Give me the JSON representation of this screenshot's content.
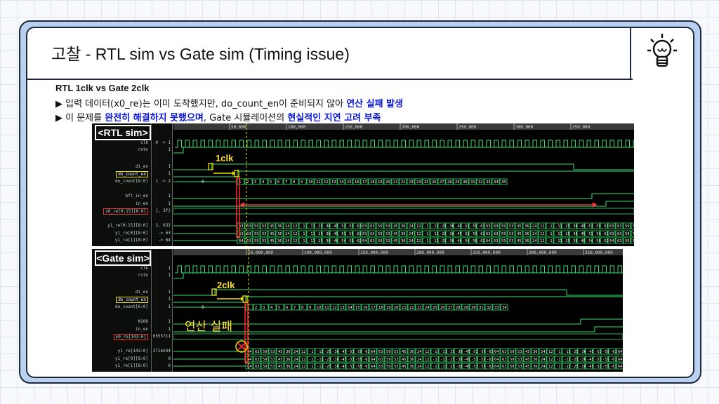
{
  "slide": {
    "title_kr": "고찰",
    "title_rest": " - RTL sim vs Gate sim (Timing issue)",
    "subtitle": "RTL 1clk vs Gate 2clk",
    "line1_a": "▶ 입력 데이터(x0_re)는 이미 도착했지만, do_count_en이 준비되지 않아 ",
    "line1_b": "연산 실패 발생",
    "line2_a": "▶ 이 문제를 ",
    "line2_b": "완전히 해결하지 못했으며",
    "line2_c": ", Gate 시뮬레이션의 ",
    "line2_d": "현실적인 지연 고려 부족",
    "icon": "lightbulb-icon"
  },
  "rtl": {
    "label": "<RTL sim>",
    "signals": [
      "clk",
      "rstn",
      "di_en",
      "do_count_en",
      "do_count[6:0]",
      "bfl_in_en",
      "in_en",
      "x0_re[0:15][8:0]",
      "y1_re[0:15][8:0]",
      "y1_re[0][8:0]",
      "y1_re[1][8:0]"
    ],
    "values": [
      "0 -> 1",
      "1",
      "1",
      "1",
      "1 -> 2",
      "1",
      "1",
      "{, 3f}",
      "3, 63}",
      "-> 63",
      "-> 64"
    ],
    "annotation": "1clk",
    "time_ticks": [
      "50,000",
      "100,000",
      "150,000",
      "200,000",
      "250,000",
      "300,000",
      "350,000"
    ],
    "counts": [
      "0",
      "1",
      "2",
      "3",
      "4",
      "5",
      "6",
      "7",
      "8",
      "9",
      "10",
      "11",
      "12",
      "13",
      "14",
      "15",
      "16",
      "17",
      "18",
      "19",
      "20",
      "21",
      "22",
      "23",
      "24",
      "25",
      "26",
      "27",
      "28",
      "29",
      "30",
      "31",
      "32",
      "33",
      "34",
      "35"
    ],
    "y0": [
      "63",
      "63",
      "59",
      "53",
      "45",
      "36",
      "24",
      "12",
      "-1",
      "-11",
      "-25",
      "-36",
      "-45",
      "-53",
      "-59",
      "-63"
    ],
    "y1": [
      "64",
      "63",
      "59",
      "53",
      "45",
      "36",
      "24",
      "12",
      "-1",
      "-11",
      "-25",
      "-36",
      "-46",
      "-54",
      "-58",
      "-62"
    ]
  },
  "gate": {
    "label": "<Gate sim>",
    "signals": [
      "clk",
      "rstn",
      "di_en",
      "do_count_en",
      "do_count[6:0]",
      "N108",
      "in_en",
      "x0_re[143:0]",
      "y1_re[143:0]",
      "y1_re[0][8:0]",
      "y1_re[1][8:0]"
    ],
    "values": [
      "1",
      "1",
      "1",
      "1",
      "1",
      "1",
      "1",
      "6555711",
      "3716544",
      "0",
      "0"
    ],
    "annotation": "2clk",
    "failure_label": "연산 실패",
    "time_ticks": [
      "50,000,000",
      "100,000,000",
      "150,000,000",
      "200,000,000",
      "250,000,000",
      "300,000,000",
      "350,000,000"
    ],
    "counts": [
      "0",
      "1",
      "2",
      "3",
      "4",
      "5",
      "6",
      "7",
      "8",
      "9",
      "10",
      "11",
      "12",
      "13",
      "14",
      "15",
      "16",
      "17",
      "18",
      "19",
      "20",
      "21",
      "22",
      "23",
      "24",
      "25",
      "26",
      "27",
      "28",
      "29",
      "30",
      "31",
      "32",
      "33",
      "34"
    ],
    "y0": [
      "64",
      "63",
      "59",
      "53",
      "45",
      "36",
      "24",
      "12",
      "-1",
      "-11",
      "-25",
      "-36",
      "-45",
      "-53",
      "-59",
      "-63"
    ],
    "y1": [
      "64",
      "63",
      "59",
      "53",
      "45",
      "36",
      "24",
      "12",
      "-1",
      "-11",
      "-25",
      "-36",
      "-45",
      "-53",
      "-59",
      "-63"
    ]
  }
}
